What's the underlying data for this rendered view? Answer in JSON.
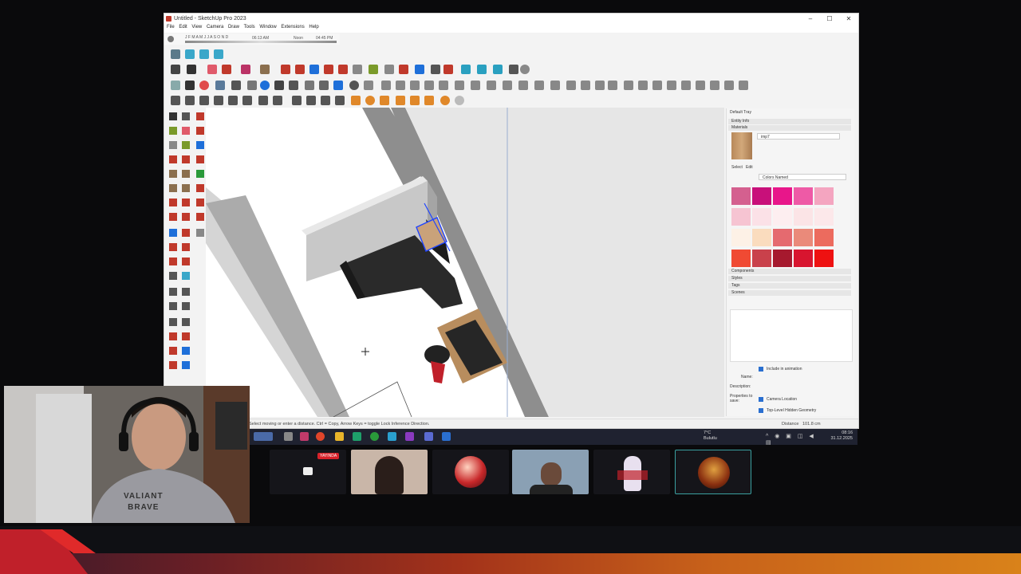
{
  "window": {
    "title": "Untitled - SketchUp Pro 2023",
    "controls": [
      "–",
      "☐",
      "✕"
    ]
  },
  "menu": [
    "File",
    "Edit",
    "View",
    "Camera",
    "Draw",
    "Tools",
    "Window",
    "Extensions",
    "Help"
  ],
  "shadow_bar": {
    "months": "J F M A M J J A S O N D",
    "time_start": "06:13 AM",
    "time_mid": "Noon",
    "time_end": "04:45 PM"
  },
  "tray": {
    "title": "Default Tray",
    "entity_info": "Entity Info",
    "materials": "Materials",
    "material_name": "imp7",
    "select_tab": "Select",
    "edit_tab": "Edit",
    "library": "Colors Named",
    "components": "Components",
    "styles": "Styles",
    "tags": "Tags",
    "scenes": "Scenes",
    "include_animation": "Include in animation",
    "name_label": "Name:",
    "description_label": "Description:",
    "properties_label": "Properties to save:",
    "camera_location": "Camera Location",
    "hidden_geometry": "Top-Level Hidden Geometry"
  },
  "swatches": [
    "#d4608f",
    "#c8107a",
    "#e8168a",
    "#ee5aa6",
    "#f4a5c0",
    "#f6c4d2",
    "#fbe1e7",
    "#fdeef0",
    "#fbe4e6",
    "#fce8ea",
    "#fdf1e6",
    "#fadcbe",
    "#e56a6f",
    "#ea8a7a",
    "#ec6b5e",
    "#f04a33",
    "#c9414b",
    "#a6192e",
    "#d8152f",
    "#ee1111"
  ],
  "status": {
    "hint": "Select moving or enter a distance. Ctrl = Copy, Arrow Keys = toggle Lock Inference Direction.",
    "distance_label": "Distance",
    "distance_value": "101.8 cm"
  },
  "taskbar": {
    "weather_temp": "7°C",
    "weather_text": "Bulutlu",
    "time": "08:16",
    "date": "31.12.2025"
  },
  "stream": {
    "live_badge": "YAYINDA",
    "webcam_shirt": "VALIANT\nBRAVE"
  }
}
